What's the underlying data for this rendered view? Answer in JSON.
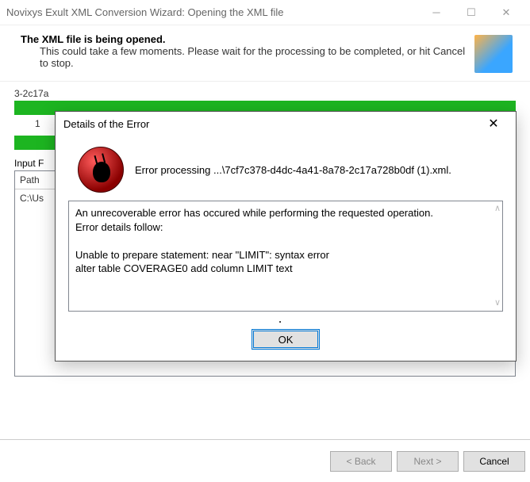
{
  "window": {
    "title": "Novixys Exult XML Conversion Wizard: Opening the XML file"
  },
  "header": {
    "heading": "The XML file is being opened.",
    "sub": "This could take a few moments. Please wait for the processing to be completed, or hit Cancel to stop."
  },
  "body": {
    "filename_trunc": "3-2c17a",
    "row_counter": "1",
    "input_label": "Input F",
    "table_header": "Path",
    "table_row": "C:\\Us"
  },
  "footer": {
    "back": "< Back",
    "next": "Next >",
    "cancel": "Cancel"
  },
  "error": {
    "title": "Details of the Error",
    "message": "Error processing ...\\7cf7c378-d4dc-4a41-8a78-2c17a728b0df (1).xml.",
    "details": "An unrecoverable error has occured while performing the requested operation.\nError details follow:\n\nUnable to prepare statement: near \"LIMIT\": syntax error\nalter table COVERAGE0 add column LIMIT text",
    "ok": "OK"
  }
}
